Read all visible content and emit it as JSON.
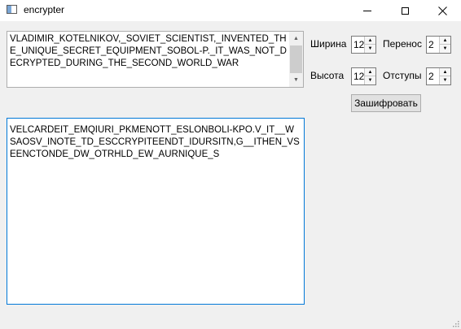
{
  "window": {
    "title": "encrypter",
    "icons": {
      "app": "app-window-icon",
      "minimize": "minimize-icon",
      "maximize": "maximize-icon",
      "close": "close-icon"
    }
  },
  "input": {
    "text": "VLADIMIR_KOTELNIKOV,_SOVIET_SCIENTIST,_INVENTED_THE_UNIQUE_SECRET_EQUIPMENT_SOBOL-P._IT_WAS_NOT_DECRYPTED_DURING_THE_SECOND_WORLD_WAR"
  },
  "params": {
    "width": {
      "label": "Ширина",
      "value": "12"
    },
    "wrap": {
      "label": "Перенос",
      "value": "2"
    },
    "height": {
      "label": "Высота",
      "value": "12"
    },
    "indent": {
      "label": "Отступы",
      "value": "2"
    }
  },
  "actions": {
    "encrypt_label": "Зашифровать"
  },
  "output": {
    "text": "VELCARDEIT_EMQIURI_PKMENOTT_ESLONBOLI-KPO.V_IT__WSAOSV_INOTE_TD_ESCCRYPITEENDT_IDURSITN,G__ITHEN_VSEENCTONDE_DW_OTRHLD_EW_AURNIQUE_S"
  }
}
